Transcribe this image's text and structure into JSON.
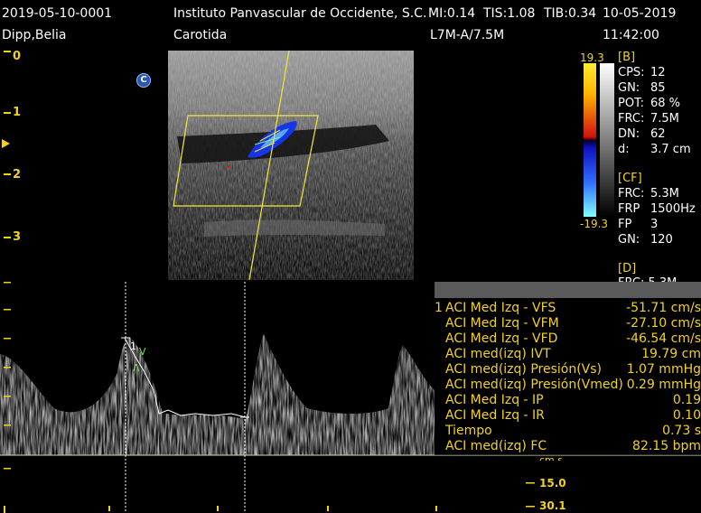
{
  "header": {
    "patient_id": "2019-05-10-0001",
    "patient_name": "Dipp,Belia",
    "institution": "Instituto Panvascular de Occidente, S.C.",
    "mi": "MI:0.14",
    "tis": "TIS:1.08",
    "tib": "TIB:0.34",
    "date": "10-05-2019",
    "exam": "Carotida",
    "probe": "L7M-A/7.5M",
    "time": "11:42:00"
  },
  "depth_scale": [
    "0",
    "1",
    "2",
    "3"
  ],
  "mode_badge": "C",
  "color_scale": {
    "top": "19.3",
    "bottom": "-19.3",
    "colors": [
      "#ffee33",
      "#d01010",
      "#1010c0",
      "#80ffff"
    ]
  },
  "b_params": {
    "section": "[B]",
    "rows": [
      {
        "label": "CPS:",
        "value": "12"
      },
      {
        "label": "GN:",
        "value": "85"
      },
      {
        "label": "POT:",
        "value": "68 %"
      },
      {
        "label": "FRC:",
        "value": "7.5M"
      },
      {
        "label": "DN:",
        "value": "62"
      },
      {
        "label": "d:",
        "value": "3.7 cm"
      }
    ]
  },
  "cf_params": {
    "section": "[CF]",
    "rows": [
      {
        "label": "FRC:",
        "value": "5.3M"
      },
      {
        "label": "FRP",
        "value": "1500Hz"
      },
      {
        "label": "FP",
        "value": "3"
      },
      {
        "label": "GN:",
        "value": "120"
      }
    ]
  },
  "d_params": {
    "section": "[D]",
    "partial": "FRC: 5.3M"
  },
  "measurements": [
    {
      "num": "1",
      "label": "ACI Med Izq - VFS",
      "value": "-51.71 cm/s"
    },
    {
      "num": "",
      "label": "ACI Med Izq - VFM",
      "value": "-27.10 cm/s"
    },
    {
      "num": "",
      "label": "ACI Med Izq - VFD",
      "value": "-46.54 cm/s"
    },
    {
      "num": "",
      "label": "ACI med(izq) IVT",
      "value": "19.79 cm"
    },
    {
      "num": "",
      "label": "ACI med(izq) Presión(Vs)",
      "value": "1.07 mmHg"
    },
    {
      "num": "",
      "label": "ACI med(izq) Presión(Vmed)",
      "value": "0.29 mmHg"
    },
    {
      "num": "",
      "label": "ACI Med Izq - IP",
      "value": "0.19"
    },
    {
      "num": "",
      "label": "ACI Med Izq - IR",
      "value": "0.10"
    },
    {
      "num": "",
      "label": "Tiempo",
      "value": "0.73 s"
    },
    {
      "num": "",
      "label": "ACI med(izq) FC",
      "value": "82.15 bpm"
    }
  ],
  "velocity_scale": {
    "partial": "cm.s",
    "mid": "15.0",
    "bottom": "30.1"
  },
  "markers": {
    "peak": "1",
    "v": "V",
    "lambda": "Λ"
  }
}
